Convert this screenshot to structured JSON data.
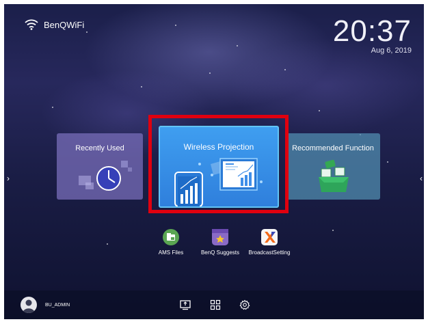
{
  "status": {
    "wifi_icon": "wifi-icon",
    "wifi_name": "BenQWiFi"
  },
  "clock": {
    "time": "20:37",
    "date": "Aug 6, 2019"
  },
  "cards": {
    "recent": {
      "title": "Recently Used",
      "icon": "clock-icon"
    },
    "wireless": {
      "title": "Wireless Projection",
      "icon": "screen-cast-icon"
    },
    "recommended": {
      "title": "Recommended Function",
      "icon": "gift-box-icon"
    }
  },
  "apps": [
    {
      "label": "AMS Files",
      "icon": "folder-icon",
      "color": "#5aa552"
    },
    {
      "label": "BenQ Suggests",
      "icon": "star-bag-icon",
      "color": "#8a6ac6"
    },
    {
      "label": "BroadcastSetting",
      "icon": "broadcast-x-icon",
      "color": "#f7f7f7"
    }
  ],
  "user": {
    "name": "BU_ADMIN",
    "icon": "user-avatar-icon"
  },
  "bottom_bar": {
    "icons": [
      "input-source-icon",
      "apps-grid-icon",
      "settings-gear-icon"
    ]
  },
  "colors": {
    "highlight": "#e0000f",
    "accent": "#3f9ef0"
  }
}
